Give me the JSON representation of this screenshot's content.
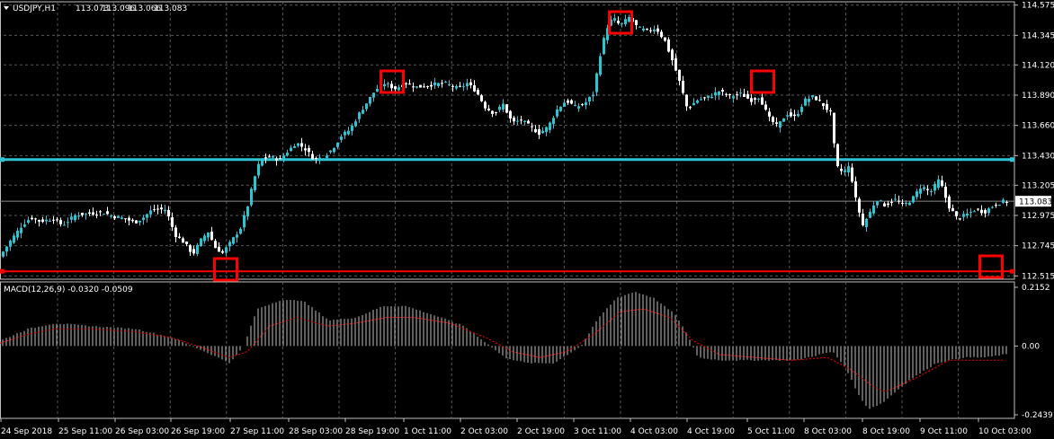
{
  "chart_data": [
    {
      "type": "candlestick",
      "title": "USDJPY,H1",
      "ohlc_readout": [
        "113.073",
        "113.096",
        "113.066",
        "113.083"
      ],
      "ylim": [
        12.5,
        114.7
      ],
      "ylim_note": "",
      "y_ticks": [
        "114.575",
        "114.345",
        "114.120",
        "113.890",
        "113.660",
        "113.430",
        "113.205",
        "112.975",
        "112.745",
        "112.515"
      ],
      "current_price_label": "113.083",
      "current_price": 113.083,
      "horizontal_lines": [
        {
          "price": 113.4,
          "color": "#2ec4d6"
        },
        {
          "price": 112.55,
          "color": "#ff0000"
        }
      ],
      "x_ticks": [
        "24 Sep 2018",
        "25 Sep 11:00",
        "26 Sep 03:00",
        "26 Sep 19:00",
        "27 Sep 11:00",
        "28 Sep 03:00",
        "28 Sep 19:00",
        "1 Oct 11:00",
        "2 Oct 03:00",
        "2 Oct 19:00",
        "3 Oct 11:00",
        "4 Oct 03:00",
        "4 Oct 19:00",
        "5 Oct 11:00",
        "8 Oct 03:00",
        "8 Oct 19:00",
        "9 Oct 11:00",
        "10 Oct 03:00"
      ],
      "grid": true,
      "up_color": "#2ec4d6",
      "down_color": "#ffffff",
      "close_path": [
        [
          0,
          112.66
        ],
        [
          12,
          112.78
        ],
        [
          25,
          112.9
        ],
        [
          35,
          112.96
        ],
        [
          45,
          112.93
        ],
        [
          60,
          112.95
        ],
        [
          70,
          112.9
        ],
        [
          85,
          112.98
        ],
        [
          100,
          112.99
        ],
        [
          115,
          113.0
        ],
        [
          125,
          112.97
        ],
        [
          140,
          112.95
        ],
        [
          150,
          112.92
        ],
        [
          160,
          112.96
        ],
        [
          170,
          113.02
        ],
        [
          185,
          113.02
        ],
        [
          195,
          112.83
        ],
        [
          205,
          112.77
        ],
        [
          215,
          112.68
        ],
        [
          225,
          112.8
        ],
        [
          232,
          112.85
        ],
        [
          240,
          112.73
        ],
        [
          248,
          112.69
        ],
        [
          258,
          112.78
        ],
        [
          268,
          112.88
        ],
        [
          276,
          113.05
        ],
        [
          283,
          113.25
        ],
        [
          290,
          113.4
        ],
        [
          300,
          113.42
        ],
        [
          312,
          113.4
        ],
        [
          320,
          113.46
        ],
        [
          330,
          113.53
        ],
        [
          340,
          113.48
        ],
        [
          350,
          113.4
        ],
        [
          360,
          113.42
        ],
        [
          370,
          113.48
        ],
        [
          380,
          113.58
        ],
        [
          390,
          113.63
        ],
        [
          400,
          113.75
        ],
        [
          410,
          113.85
        ],
        [
          418,
          113.93
        ],
        [
          428,
          113.98
        ],
        [
          440,
          113.94
        ],
        [
          452,
          113.98
        ],
        [
          465,
          113.95
        ],
        [
          480,
          113.97
        ],
        [
          495,
          113.98
        ],
        [
          510,
          113.94
        ],
        [
          520,
          113.98
        ],
        [
          530,
          113.92
        ],
        [
          540,
          113.8
        ],
        [
          550,
          113.75
        ],
        [
          560,
          113.82
        ],
        [
          570,
          113.68
        ],
        [
          580,
          113.7
        ],
        [
          590,
          113.65
        ],
        [
          600,
          113.6
        ],
        [
          610,
          113.65
        ],
        [
          620,
          113.78
        ],
        [
          630,
          113.85
        ],
        [
          640,
          113.8
        ],
        [
          650,
          113.82
        ],
        [
          660,
          113.9
        ],
        [
          668,
          114.2
        ],
        [
          675,
          114.4
        ],
        [
          682,
          114.48
        ],
        [
          690,
          114.42
        ],
        [
          700,
          114.48
        ],
        [
          710,
          114.4
        ],
        [
          720,
          114.38
        ],
        [
          730,
          114.4
        ],
        [
          740,
          114.3
        ],
        [
          750,
          114.12
        ],
        [
          758,
          113.95
        ],
        [
          765,
          113.78
        ],
        [
          775,
          113.85
        ],
        [
          790,
          113.88
        ],
        [
          800,
          113.92
        ],
        [
          812,
          113.88
        ],
        [
          825,
          113.9
        ],
        [
          835,
          113.85
        ],
        [
          845,
          113.88
        ],
        [
          855,
          113.72
        ],
        [
          865,
          113.65
        ],
        [
          875,
          113.75
        ],
        [
          885,
          113.72
        ],
        [
          895,
          113.85
        ],
        [
          905,
          113.88
        ],
        [
          915,
          113.82
        ],
        [
          925,
          113.75
        ],
        [
          930,
          113.35
        ],
        [
          938,
          113.3
        ],
        [
          945,
          113.35
        ],
        [
          952,
          113.1
        ],
        [
          960,
          112.9
        ],
        [
          968,
          113.0
        ],
        [
          975,
          113.1
        ],
        [
          985,
          113.05
        ],
        [
          995,
          113.1
        ],
        [
          1005,
          113.05
        ],
        [
          1015,
          113.1
        ],
        [
          1025,
          113.2
        ],
        [
          1035,
          113.15
        ],
        [
          1045,
          113.25
        ],
        [
          1055,
          113.05
        ],
        [
          1065,
          112.95
        ],
        [
          1075,
          112.98
        ],
        [
          1085,
          113.02
        ],
        [
          1095,
          113.0
        ],
        [
          1105,
          113.05
        ],
        [
          1115,
          113.08
        ]
      ],
      "markers": [
        {
          "index": 64,
          "color": "#ff0000"
        },
        {
          "index": 41,
          "color": "#ff0000"
        },
        {
          "index": 84,
          "color": "#ff0000"
        },
        {
          "index": 23,
          "color": "#ff0000"
        },
        {
          "index": 110,
          "color": "#ff0000"
        }
      ]
    },
    {
      "type": "bar",
      "title": "MACD(12,26,9) -0.0320 -0.0509",
      "y_ticks": [
        "0.2152",
        "0.00",
        "-0.2439"
      ],
      "ylim": [
        -0.2439,
        0.2152
      ],
      "hist_color": "#c0c0c0",
      "signal_color": "#ff0000",
      "hist_path": [
        [
          0,
          0.02
        ],
        [
          30,
          0.06
        ],
        [
          60,
          0.08
        ],
        [
          100,
          0.07
        ],
        [
          150,
          0.06
        ],
        [
          190,
          0.03
        ],
        [
          220,
          -0.01
        ],
        [
          255,
          -0.06
        ],
        [
          270,
          0.0
        ],
        [
          285,
          0.13
        ],
        [
          310,
          0.16
        ],
        [
          335,
          0.16
        ],
        [
          365,
          0.09
        ],
        [
          395,
          0.1
        ],
        [
          425,
          0.14
        ],
        [
          450,
          0.14
        ],
        [
          480,
          0.11
        ],
        [
          515,
          0.07
        ],
        [
          540,
          0.01
        ],
        [
          560,
          -0.04
        ],
        [
          585,
          -0.06
        ],
        [
          615,
          -0.06
        ],
        [
          645,
          0.0
        ],
        [
          665,
          0.1
        ],
        [
          685,
          0.17
        ],
        [
          705,
          0.19
        ],
        [
          725,
          0.17
        ],
        [
          750,
          0.11
        ],
        [
          765,
          0.03
        ],
        [
          775,
          -0.04
        ],
        [
          800,
          -0.05
        ],
        [
          830,
          -0.05
        ],
        [
          860,
          -0.05
        ],
        [
          885,
          -0.05
        ],
        [
          910,
          -0.03
        ],
        [
          925,
          -0.02
        ],
        [
          940,
          -0.08
        ],
        [
          955,
          -0.18
        ],
        [
          965,
          -0.22
        ],
        [
          980,
          -0.2
        ],
        [
          1010,
          -0.12
        ],
        [
          1040,
          -0.06
        ],
        [
          1070,
          -0.04
        ],
        [
          1095,
          -0.04
        ],
        [
          1115,
          -0.03
        ]
      ],
      "signal_path": [
        [
          0,
          0.01
        ],
        [
          30,
          0.04
        ],
        [
          60,
          0.06
        ],
        [
          100,
          0.06
        ],
        [
          150,
          0.05
        ],
        [
          190,
          0.03
        ],
        [
          220,
          0.0
        ],
        [
          255,
          -0.04
        ],
        [
          275,
          -0.02
        ],
        [
          300,
          0.07
        ],
        [
          330,
          0.1
        ],
        [
          365,
          0.07
        ],
        [
          395,
          0.08
        ],
        [
          430,
          0.1
        ],
        [
          460,
          0.1
        ],
        [
          500,
          0.08
        ],
        [
          540,
          0.03
        ],
        [
          570,
          -0.02
        ],
        [
          600,
          -0.04
        ],
        [
          630,
          -0.02
        ],
        [
          660,
          0.04
        ],
        [
          690,
          0.12
        ],
        [
          715,
          0.13
        ],
        [
          745,
          0.1
        ],
        [
          770,
          0.02
        ],
        [
          800,
          -0.03
        ],
        [
          840,
          -0.04
        ],
        [
          880,
          -0.05
        ],
        [
          920,
          -0.04
        ],
        [
          945,
          -0.08
        ],
        [
          970,
          -0.14
        ],
        [
          985,
          -0.16
        ],
        [
          1020,
          -0.11
        ],
        [
          1055,
          -0.05
        ],
        [
          1090,
          -0.05
        ],
        [
          1115,
          -0.05
        ]
      ]
    }
  ]
}
